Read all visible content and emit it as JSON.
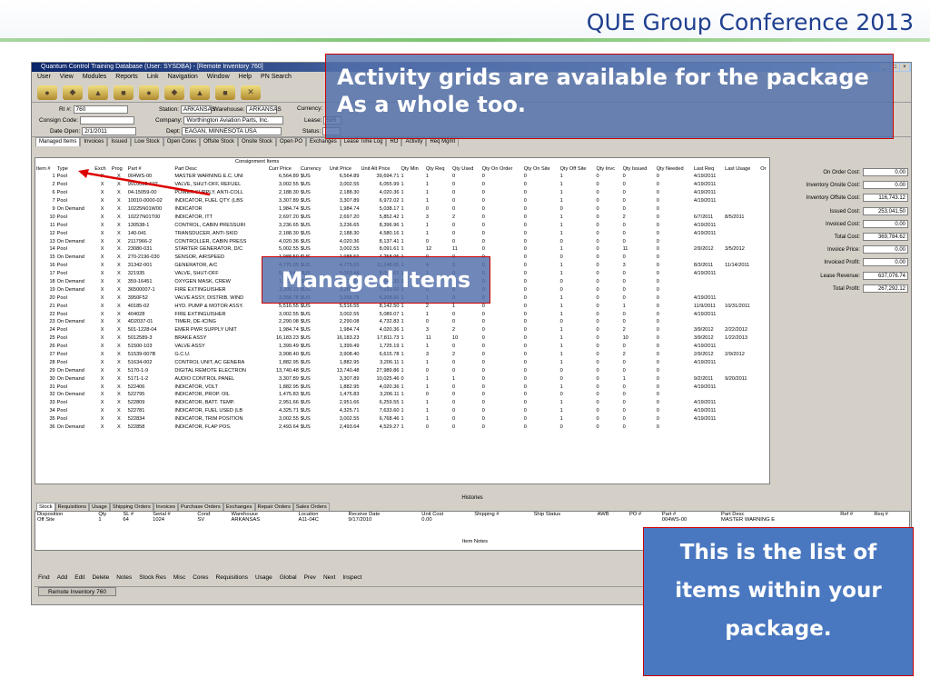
{
  "slide_title": "QUE Group Conference 2013",
  "window": {
    "title": "Quantum Control Training Database (User: SYSDBA) - [Remote Inventory 760]",
    "buttons": [
      "_",
      "□",
      "×"
    ]
  },
  "menu": [
    "User",
    "View",
    "Modules",
    "Reports",
    "Link",
    "Navigation",
    "Window",
    "Help",
    "PN Search"
  ],
  "header": {
    "ri_label": "RI #:",
    "ri_value": "760",
    "station_label": "Station:",
    "station_value": "ARKANSAS",
    "warehouse_label": "Warehouse:",
    "warehouse_value": "ARKANSAS",
    "currency_label": "Currency:",
    "consign_label": "Consign Code:",
    "company_label": "Company:",
    "company_value": "Worthington Aviation Parts, Inc.",
    "lease_label": "Lease:",
    "lease_value": "585",
    "date_label": "Date Open:",
    "date_value": "2/1/2011",
    "dept_label": "Dept:",
    "dept_value": "EAGAN, MINNESOTA USA",
    "status_label": "Status:"
  },
  "tabs": [
    "Managed Items",
    "Invoices",
    "Issued",
    "Low Stock",
    "Open Cores",
    "Offsite Stock",
    "Onsite Stock",
    "Open PO",
    "Exchanges",
    "Lease Time Log",
    "RO",
    "Activity",
    "Req Mgmt"
  ],
  "grid": {
    "group_header": "Consignment Items",
    "columns": [
      "Item #",
      "Type",
      "Exch",
      "Prog",
      "Part #",
      "Part Desc",
      "Curr Price",
      "Currency",
      "Unit Price",
      "Unit Alt Price",
      "Qty Min",
      "Qty Req",
      "Qty Used",
      "Qty On Order",
      "Qty On Site",
      "Qty Off Site",
      "Qty Invc",
      "Qty Issued",
      "Qty Needed",
      "Last Req",
      "Last Usage",
      "Or"
    ],
    "rows": [
      [
        "1",
        "Pool",
        "X",
        "X",
        "004WS-00",
        "MASTER WARNING E.C. UNI",
        "6,564.89",
        "$US",
        "6,564.89",
        "39,694.71",
        "1",
        "1",
        "0",
        "0",
        "0",
        "1",
        "0",
        "0",
        "0",
        "4/19/2011",
        ""
      ],
      [
        "2",
        "Pool",
        "X",
        "X",
        "9910022-102",
        "VALVE, SHUT-OFF, REFUEL",
        "3,002.55",
        "$US",
        "3,002.55",
        "6,055.99",
        "1",
        "1",
        "0",
        "0",
        "0",
        "1",
        "0",
        "0",
        "0",
        "4/19/2011",
        ""
      ],
      [
        "6",
        "Pool",
        "X",
        "X",
        "04-15059-00",
        "POWER SUPPLY, ANTI-COLL",
        "2,188.30",
        "$US",
        "2,188.30",
        "4,020.36",
        "1",
        "1",
        "0",
        "0",
        "0",
        "1",
        "0",
        "0",
        "0",
        "4/19/2011",
        ""
      ],
      [
        "7",
        "Pool",
        "X",
        "X",
        "10010-0000-02",
        "INDICATOR, FUEL QTY. (LBS",
        "3,307.89",
        "$US",
        "3,307.89",
        "6,972.02",
        "1",
        "1",
        "0",
        "0",
        "0",
        "1",
        "0",
        "0",
        "0",
        "4/19/2011",
        ""
      ],
      [
        "9",
        "On Demand",
        "X",
        "X",
        "10225N01W00",
        "INDICATOR",
        "1,984.74",
        "$US",
        "1,984.74",
        "5,038.17",
        "1",
        "0",
        "0",
        "0",
        "0",
        "0",
        "0",
        "0",
        "0",
        "",
        ""
      ],
      [
        "10",
        "Pool",
        "X",
        "X",
        "10227N01T00",
        "INDICATOR, ITT",
        "2,697.20",
        "$US",
        "2,697.20",
        "5,852.42",
        "1",
        "3",
        "2",
        "0",
        "0",
        "1",
        "0",
        "2",
        "0",
        "6/7/2011",
        "8/5/2011"
      ],
      [
        "11",
        "Pool",
        "X",
        "X",
        "130538-1",
        "CONTROL, CABIN PRESSURI",
        "3,236.65",
        "$US",
        "3,236.65",
        "8,396.96",
        "1",
        "1",
        "0",
        "0",
        "0",
        "1",
        "0",
        "0",
        "0",
        "4/19/2011",
        ""
      ],
      [
        "12",
        "Pool",
        "X",
        "X",
        "140-041",
        "TRANSDUCER, ANTI-SKID",
        "2,188.30",
        "$US",
        "2,188.30",
        "4,580.16",
        "1",
        "1",
        "0",
        "0",
        "0",
        "1",
        "0",
        "0",
        "0",
        "4/19/2011",
        ""
      ],
      [
        "13",
        "On Demand",
        "X",
        "X",
        "2117966-2",
        "CONTROLLER, CABIN PRESS",
        "4,020.36",
        "$US",
        "4,020.36",
        "8,137.41",
        "1",
        "0",
        "0",
        "0",
        "0",
        "0",
        "0",
        "0",
        "0",
        "",
        ""
      ],
      [
        "14",
        "Pool",
        "X",
        "X",
        "23080-031",
        "STARTER GENERATOR, D/C",
        "5,002.55",
        "$US",
        "3,002.55",
        "8,091.61",
        "1",
        "12",
        "11",
        "0",
        "0",
        "1",
        "0",
        "11",
        "0",
        "2/9/2012",
        "3/5/2012"
      ],
      [
        "15",
        "On Demand",
        "X",
        "X",
        "270-2196-030",
        "SENSOR, AIRSPEED",
        "1,988.59",
        "$US",
        "1,988.59",
        "4,258.95",
        "1",
        "0",
        "0",
        "0",
        "0",
        "0",
        "0",
        "0",
        "0",
        "",
        ""
      ],
      [
        "16",
        "Pool",
        "X",
        "X",
        "31342-001",
        "GENERATOR, A/C",
        "4,775.05",
        "$US",
        "4,775.05",
        "11,248.05",
        "1",
        "4",
        "3",
        "0",
        "0",
        "1",
        "0",
        "3",
        "0",
        "8/3/2011",
        "11/14/2011"
      ],
      [
        "17",
        "Pool",
        "X",
        "X",
        "321935",
        "VALVE, SHUT-OFF",
        "5,053.44",
        "$US",
        "5,053.44",
        "8,091.61",
        "1",
        "1",
        "0",
        "0",
        "0",
        "1",
        "0",
        "0",
        "0",
        "4/19/2011",
        ""
      ],
      [
        "18",
        "On Demand",
        "X",
        "X",
        "359-16451",
        "OXYGEN MASK, CREW",
        "1,272.27",
        "$US",
        "1,272.27",
        "2,646.31",
        "1",
        "0",
        "0",
        "0",
        "0",
        "0",
        "0",
        "0",
        "0",
        "",
        ""
      ],
      [
        "19",
        "On Demand",
        "X",
        "X",
        "36500007-1",
        "FIRE EXTINGUISHER",
        "3,206.11",
        "$US",
        "3,206.11",
        "7,633.60",
        "1",
        "0",
        "0",
        "0",
        "0",
        "0",
        "0",
        "0",
        "0",
        "",
        ""
      ],
      [
        "20",
        "Pool",
        "X",
        "X",
        "3950F52",
        "VALVE ASSY, DISTRIB. WIND",
        "3,358.78",
        "$US",
        "3,358.78",
        "6,208.66",
        "1",
        "1",
        "0",
        "0",
        "0",
        "1",
        "0",
        "0",
        "0",
        "4/19/2011",
        ""
      ],
      [
        "21",
        "Pool",
        "X",
        "X",
        "40185-02",
        "HYD. PUMP & MOTOR ASSY.",
        "5,516.55",
        "$US",
        "5,516.55",
        "8,142.50",
        "1",
        "2",
        "1",
        "0",
        "0",
        "1",
        "0",
        "1",
        "0",
        "11/9/2011",
        "10/31/2011"
      ],
      [
        "22",
        "Pool",
        "X",
        "X",
        "404028",
        "FIRE EXTINGUISHER",
        "3,002.55",
        "$US",
        "3,002.55",
        "5,089.07",
        "1",
        "1",
        "0",
        "0",
        "0",
        "1",
        "0",
        "0",
        "0",
        "4/19/2011",
        ""
      ],
      [
        "23",
        "On Demand",
        "X",
        "X",
        "4D2037-01",
        "TIMER, DE-ICING",
        "2,290.08",
        "$US",
        "2,290.08",
        "4,732.83",
        "1",
        "0",
        "0",
        "0",
        "0",
        "0",
        "0",
        "0",
        "0",
        "",
        ""
      ],
      [
        "24",
        "Pool",
        "X",
        "X",
        "501-1228-04",
        "EMER PWR SUPPLY UNIT",
        "1,984.74",
        "$US",
        "1,984.74",
        "4,020.36",
        "1",
        "3",
        "2",
        "0",
        "0",
        "1",
        "0",
        "2",
        "0",
        "3/9/2012",
        "2/22/2012"
      ],
      [
        "25",
        "Pool",
        "X",
        "X",
        "5012589-3",
        "BRAKE ASSY",
        "16,183.23",
        "$US",
        "16,183.23",
        "17,811.73",
        "1",
        "11",
        "10",
        "0",
        "0",
        "1",
        "0",
        "10",
        "0",
        "3/9/2012",
        "1/22/2013"
      ],
      [
        "26",
        "Pool",
        "X",
        "X",
        "51500-103",
        "VALVE ASSY",
        "1,399.49",
        "$US",
        "1,399.49",
        "1,725.19",
        "1",
        "1",
        "0",
        "0",
        "0",
        "1",
        "0",
        "0",
        "0",
        "4/19/2011",
        ""
      ],
      [
        "27",
        "Pool",
        "X",
        "X",
        "51539-007B",
        "G.C.U.",
        "3,908.40",
        "$US",
        "3,908.40",
        "6,615.78",
        "1",
        "3",
        "2",
        "0",
        "0",
        "1",
        "0",
        "2",
        "0",
        "2/9/2012",
        "2/9/2012"
      ],
      [
        "28",
        "Pool",
        "X",
        "X",
        "51634-002",
        "CONTROL UNIT, AC GENERA",
        "1,882.95",
        "$US",
        "1,882.95",
        "3,206.11",
        "1",
        "1",
        "0",
        "0",
        "0",
        "1",
        "0",
        "0",
        "0",
        "4/19/2011",
        ""
      ],
      [
        "29",
        "On Demand",
        "X",
        "X",
        "5170-1-9",
        "DIGITAL REMOTE ELECTRON",
        "13,740.48",
        "$US",
        "13,740.48",
        "27,989.86",
        "1",
        "0",
        "0",
        "0",
        "0",
        "0",
        "0",
        "0",
        "0",
        "",
        ""
      ],
      [
        "30",
        "On Demand",
        "X",
        "X",
        "5171-1-2",
        "AUDIO CONTROL PANEL",
        "3,307.89",
        "$US",
        "3,307.89",
        "10,025.46",
        "0",
        "1",
        "1",
        "0",
        "0",
        "0",
        "0",
        "1",
        "0",
        "9/2/2011",
        "9/20/2011"
      ],
      [
        "31",
        "Pool",
        "X",
        "X",
        "522406",
        "INDICATOR, VOLT",
        "1,882.95",
        "$US",
        "1,882.95",
        "4,020.36",
        "1",
        "1",
        "0",
        "0",
        "0",
        "1",
        "0",
        "0",
        "0",
        "4/19/2011",
        ""
      ],
      [
        "32",
        "On Demand",
        "X",
        "X",
        "522795",
        "INDICATOR, PROP. OIL",
        "1,475.83",
        "$US",
        "1,475.83",
        "3,206.11",
        "1",
        "0",
        "0",
        "0",
        "0",
        "0",
        "0",
        "0",
        "0",
        "",
        ""
      ],
      [
        "33",
        "Pool",
        "X",
        "X",
        "522809",
        "INDICATOR, BATT. TEMP.",
        "2,951.66",
        "$US",
        "2,951.66",
        "6,259.55",
        "1",
        "1",
        "0",
        "0",
        "0",
        "1",
        "0",
        "0",
        "0",
        "4/19/2011",
        ""
      ],
      [
        "34",
        "Pool",
        "X",
        "X",
        "522781",
        "INDICATOR, FUEL USED (LB",
        "4,325.71",
        "$US",
        "4,325.71",
        "7,633.60",
        "1",
        "1",
        "0",
        "0",
        "0",
        "1",
        "0",
        "0",
        "0",
        "4/19/2011",
        ""
      ],
      [
        "35",
        "Pool",
        "X",
        "X",
        "522834",
        "INDICATOR, TRIM POSITION",
        "3,002.55",
        "$US",
        "3,002.55",
        "6,768.46",
        "1",
        "1",
        "0",
        "0",
        "0",
        "1",
        "0",
        "0",
        "0",
        "4/19/2011",
        ""
      ],
      [
        "36",
        "On Demand",
        "X",
        "X",
        "522858",
        "INDICATOR, FLAP POS.",
        "2,493.64",
        "$US",
        "2,493.64",
        "4,529.27",
        "1",
        "0",
        "0",
        "0",
        "0",
        "0",
        "0",
        "0",
        "0",
        "",
        ""
      ]
    ]
  },
  "side_panel": [
    {
      "label": "On Order Cost:",
      "value": "0.00"
    },
    {
      "label": "Inventory Onsite Cost:",
      "value": "0.00"
    },
    {
      "label": "Inventory Offsite Cost:",
      "value": "116,743.12"
    },
    {
      "label": "Issued Cost:",
      "value": "253,041.50"
    },
    {
      "label": "Invoiced Cost:",
      "value": "0.00"
    },
    {
      "label": "Total Cost:",
      "value": "369,784.62"
    },
    {
      "label": "Invoice Price:",
      "value": "0.00"
    },
    {
      "label": "Invoiced Profit:",
      "value": "0.00"
    },
    {
      "label": "Lease Revenue:",
      "value": "637,076.74"
    },
    {
      "label": "Total Profit:",
      "value": "267,292.12"
    }
  ],
  "histories": {
    "label": "Histories",
    "tabs": [
      "Stock",
      "Requisitions",
      "Usage",
      "Shipping Orders",
      "Invoices",
      "Purchase Orders",
      "Exchanges",
      "Repair Orders",
      "Sales Orders"
    ],
    "columns": [
      "Disposition",
      "Qty",
      "SL #",
      "Serial #",
      "Cond",
      "Warehouse",
      "Location",
      "Receive Date",
      "Unit Cost",
      "Shipping #",
      "Ship Status",
      "AWB",
      "PO #",
      "Part #",
      "Part Desc",
      "Ref #",
      "Req #"
    ],
    "row": [
      "Off Site",
      "1",
      "64",
      "1024",
      "SV",
      "ARKANSAS",
      "A11-04C",
      "9/17/2010",
      "0.00",
      "",
      "",
      "",
      "",
      "004WS-00",
      "MASTER WARNING E",
      "",
      ""
    ],
    "item_notes": "Item Notes"
  },
  "bottom_bar": [
    "Find",
    "Add",
    "Edit",
    "Delete",
    "Notes",
    "Stock Res",
    "Misc",
    "Cores",
    "Requisitions",
    "Usage",
    "Global",
    "Prev",
    "Next",
    "Inspect"
  ],
  "status_bar": "Remote Inventory 760",
  "callouts": {
    "activity": "Activity grids are available for the package As a whole too.",
    "managed": "Managed Items",
    "list": "This is the list of items within your package."
  }
}
